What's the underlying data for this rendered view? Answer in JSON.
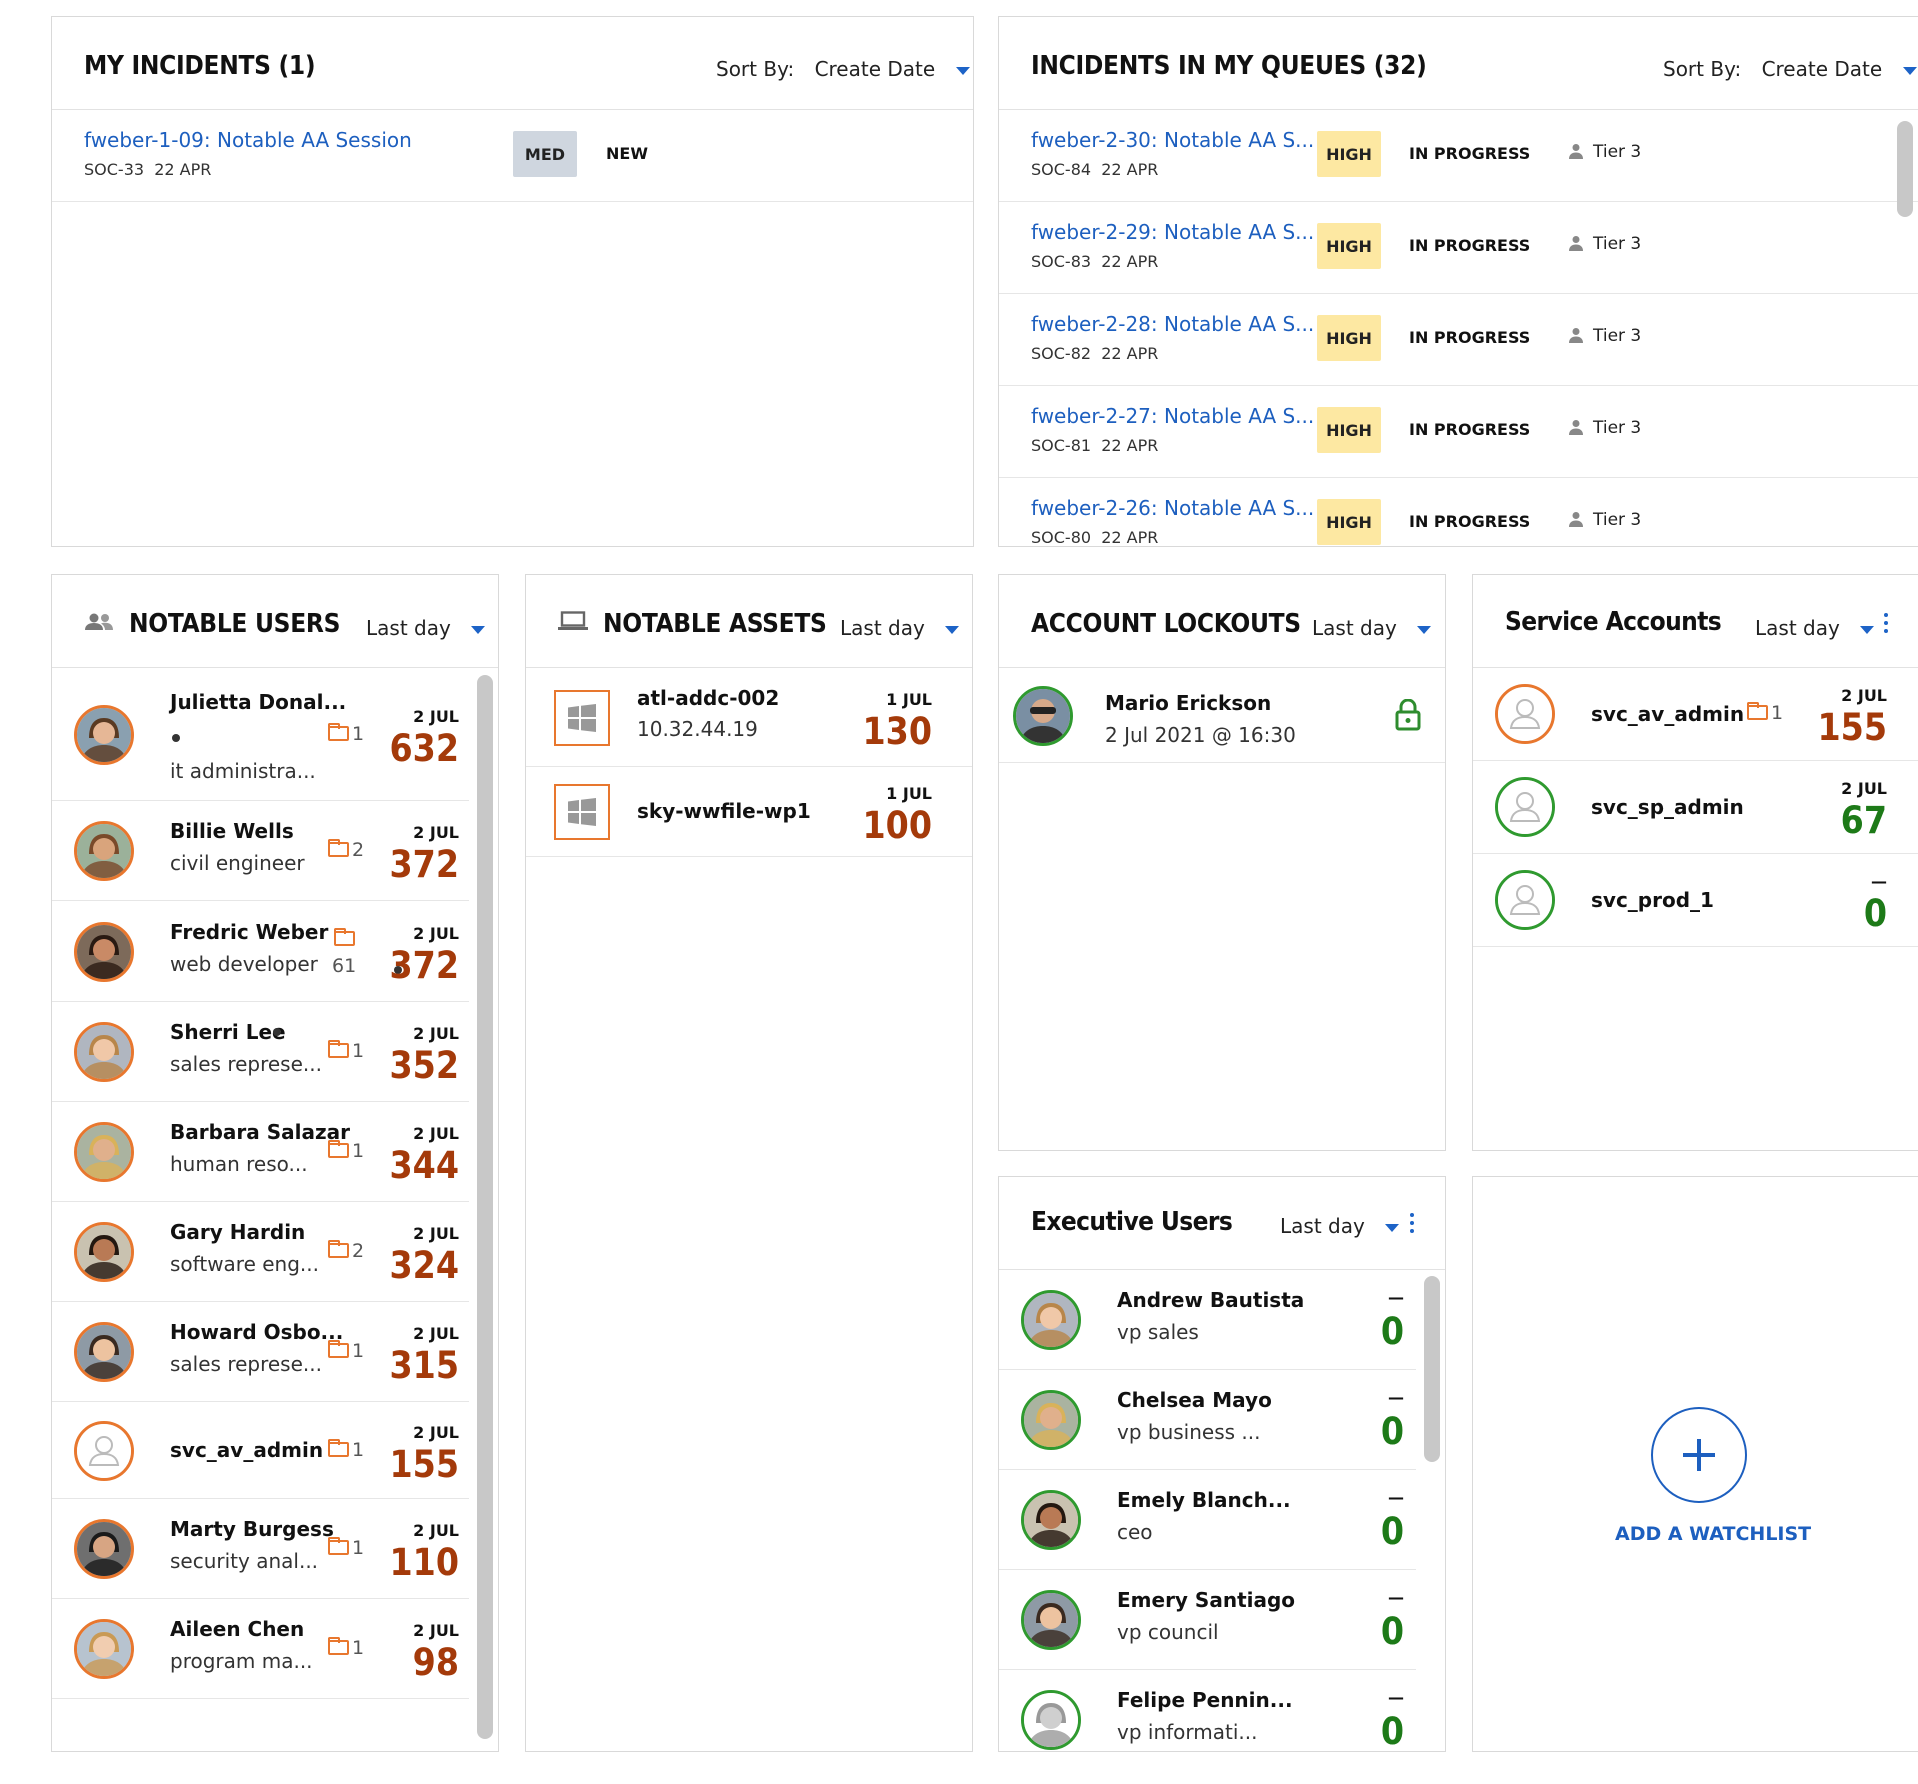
{
  "my_incidents": {
    "title": "MY INCIDENTS (1)",
    "sort_label": "Sort By:",
    "sort_value": "Create Date",
    "rows": [
      {
        "title": "fweber-1-09: Notable AA Session",
        "id": "SOC-33",
        "date": "22 APR",
        "severity": "MED",
        "status": "NEW"
      }
    ]
  },
  "queue_incidents": {
    "title": "INCIDENTS IN MY QUEUES (32)",
    "sort_label": "Sort By:",
    "sort_value": "Create Date",
    "rows": [
      {
        "title": "fweber-2-30: Notable AA S...",
        "id": "SOC-84",
        "date": "22 APR",
        "severity": "HIGH",
        "status": "IN PROGRESS",
        "assignee": "Tier 3"
      },
      {
        "title": "fweber-2-29: Notable AA S...",
        "id": "SOC-83",
        "date": "22 APR",
        "severity": "HIGH",
        "status": "IN PROGRESS",
        "assignee": "Tier 3"
      },
      {
        "title": "fweber-2-28: Notable AA S...",
        "id": "SOC-82",
        "date": "22 APR",
        "severity": "HIGH",
        "status": "IN PROGRESS",
        "assignee": "Tier 3"
      },
      {
        "title": "fweber-2-27: Notable AA S...",
        "id": "SOC-81",
        "date": "22 APR",
        "severity": "HIGH",
        "status": "IN PROGRESS",
        "assignee": "Tier 3"
      },
      {
        "title": "fweber-2-26: Notable AA S...",
        "id": "SOC-80",
        "date": "22 APR",
        "severity": "HIGH",
        "status": "IN PROGRESS",
        "assignee": "Tier 3"
      }
    ]
  },
  "notable_users": {
    "title": "NOTABLE USERS",
    "range": "Last day",
    "icon": "users-icon",
    "rows": [
      {
        "name": "Julietta Donal...",
        "role": "it administra...",
        "folders": "1",
        "date": "2 JUL",
        "score": "632"
      },
      {
        "name": "Billie Wells",
        "role": "civil engineer",
        "folders": "2",
        "date": "2 JUL",
        "score": "372"
      },
      {
        "name": "Fredric Weber",
        "role": "web developer",
        "folders": "61",
        "date": "2 JUL",
        "score": "372"
      },
      {
        "name": "Sherri Lee",
        "role": "sales represe...",
        "folders": "1",
        "date": "2 JUL",
        "score": "352"
      },
      {
        "name": "Barbara Salazar",
        "role": "human reso...",
        "folders": "1",
        "date": "2 JUL",
        "score": "344"
      },
      {
        "name": "Gary Hardin",
        "role": "software eng...",
        "folders": "2",
        "date": "2 JUL",
        "score": "324"
      },
      {
        "name": "Howard Osbo...",
        "role": "sales represe...",
        "folders": "1",
        "date": "2 JUL",
        "score": "315"
      },
      {
        "name": "svc_av_admin",
        "role": "",
        "folders": "1",
        "date": "2 JUL",
        "score": "155"
      },
      {
        "name": "Marty Burgess",
        "role": "security anal...",
        "folders": "1",
        "date": "2 JUL",
        "score": "110"
      },
      {
        "name": "Aileen Chen",
        "role": "program ma...",
        "folders": "1",
        "date": "2 JUL",
        "score": "98"
      }
    ]
  },
  "notable_assets": {
    "title": "NOTABLE ASSETS",
    "range": "Last day",
    "icon": "laptop-icon",
    "rows": [
      {
        "name": "atl-addc-002",
        "ip": "10.32.44.19",
        "date": "1 JUL",
        "score": "130"
      },
      {
        "name": "sky-wwfile-wp1",
        "ip": "",
        "date": "1 JUL",
        "score": "100"
      }
    ]
  },
  "account_lockouts": {
    "title": "ACCOUNT LOCKOUTS",
    "range": "Last day",
    "rows": [
      {
        "name": "Mario Erickson",
        "time": "2 Jul 2021 @ 16:30"
      }
    ]
  },
  "service_accounts": {
    "title": "Service Accounts",
    "range": "Last day",
    "rows": [
      {
        "name": "svc_av_admin",
        "folders": "1",
        "date": "2 JUL",
        "score": "155"
      },
      {
        "name": "svc_sp_admin",
        "folders": "",
        "date": "2 JUL",
        "score": "67"
      },
      {
        "name": "svc_prod_1",
        "folders": "",
        "date": "—",
        "score": "0"
      }
    ]
  },
  "executive_users": {
    "title": "Executive Users",
    "range": "Last day",
    "rows": [
      {
        "name": "Andrew Bautista",
        "role": "vp sales",
        "date": "—",
        "score": "0"
      },
      {
        "name": "Chelsea Mayo",
        "role": "vp business ...",
        "date": "—",
        "score": "0"
      },
      {
        "name": "Emely Blanch...",
        "role": "ceo",
        "date": "—",
        "score": "0"
      },
      {
        "name": "Emery Santiago",
        "role": "vp council",
        "date": "—",
        "score": "0"
      },
      {
        "name": "Felipe Pennin...",
        "role": "vp informati...",
        "date": "—",
        "score": "0"
      }
    ]
  },
  "add_watchlist": {
    "label": "ADD A WATCHLIST"
  },
  "colors": {
    "accent": "#1d5fbf",
    "score_orange": "#a43a0a",
    "score_green": "#1d7a18",
    "high_badge": "#fde8a2",
    "med_badge": "#cfd6df",
    "avatar_ring": "#e8772e"
  }
}
